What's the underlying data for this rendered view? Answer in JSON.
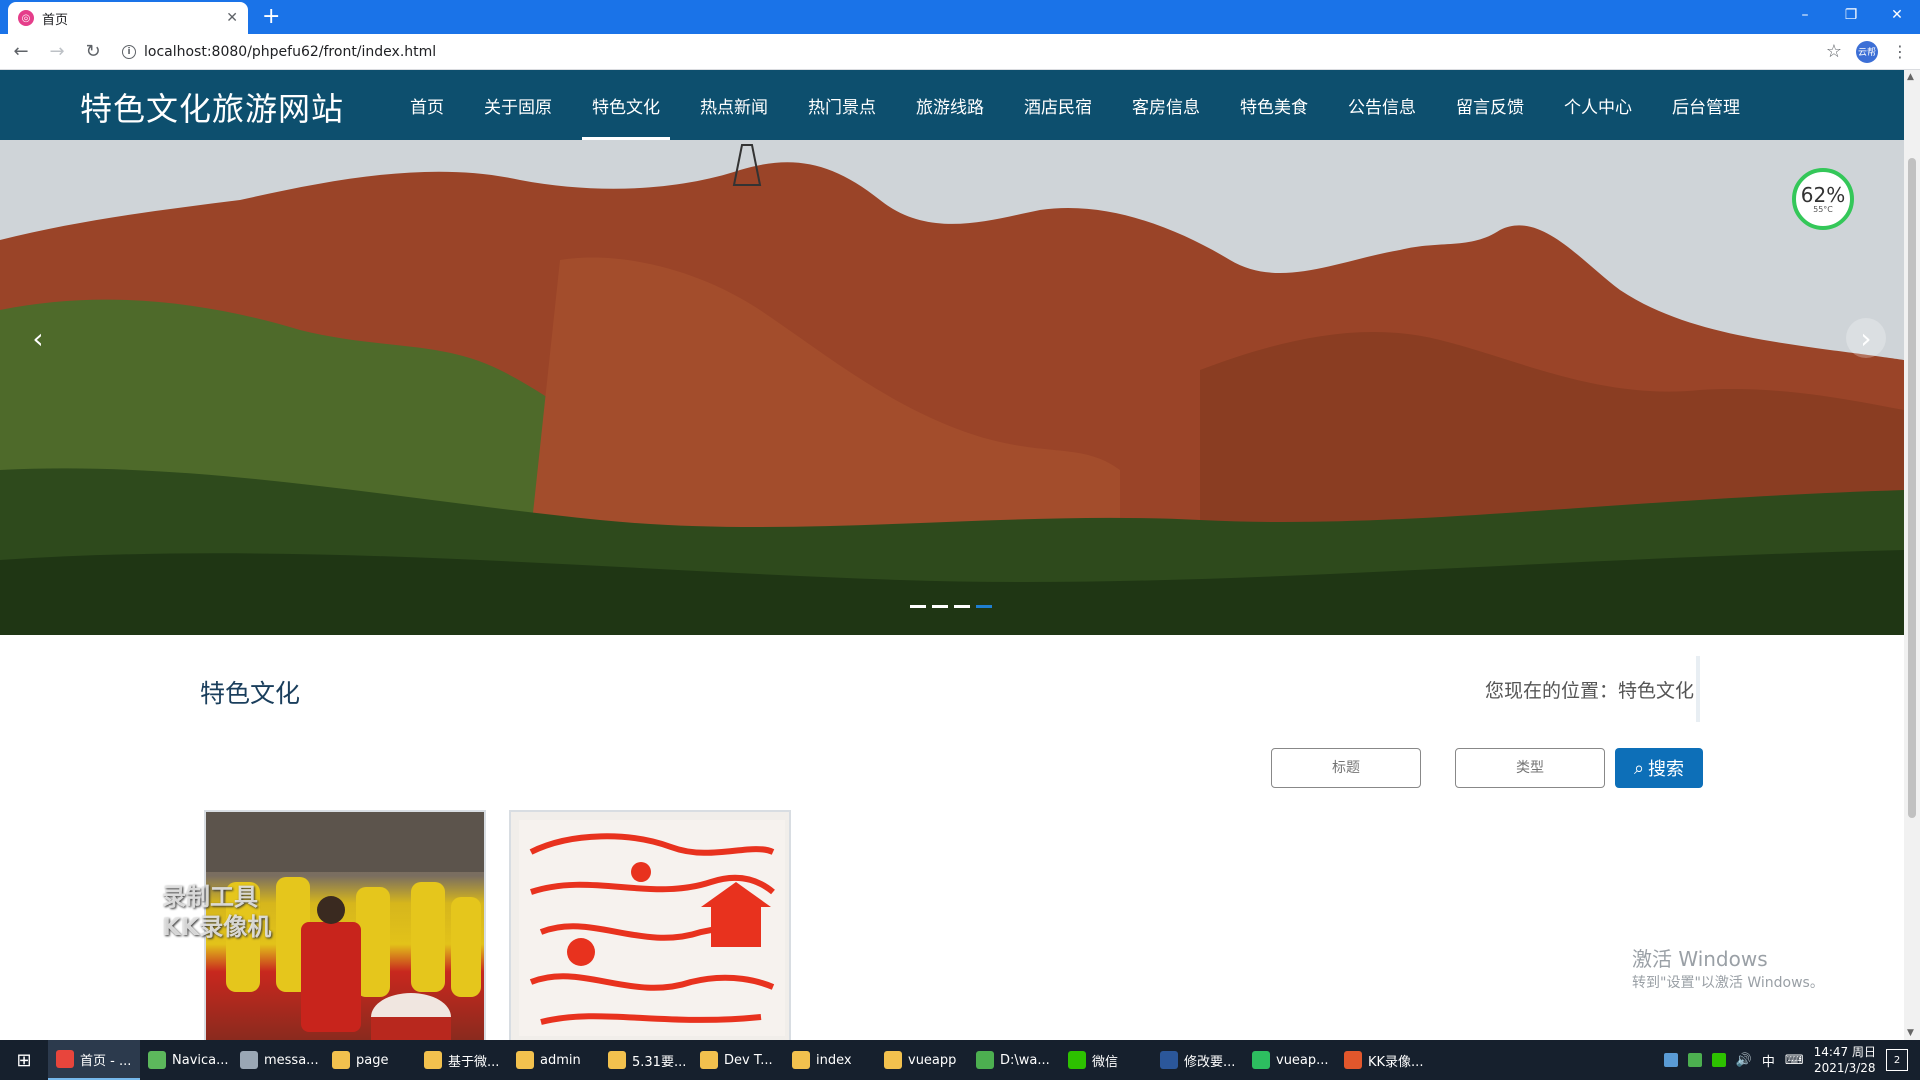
{
  "browser": {
    "tab_title": "首页",
    "url": "localhost:8080/phpefu62/front/index.html",
    "profile_label": "云帮",
    "new_tab": "+",
    "minimize": "–",
    "restore": "❐",
    "close": "✕"
  },
  "site": {
    "logo": "特色文化旅游网站",
    "nav": [
      {
        "label": "首页"
      },
      {
        "label": "关于固原"
      },
      {
        "label": "特色文化",
        "active": true
      },
      {
        "label": "热点新闻"
      },
      {
        "label": "热门景点"
      },
      {
        "label": "旅游线路"
      },
      {
        "label": "酒店民宿"
      },
      {
        "label": "客房信息"
      },
      {
        "label": "特色美食"
      },
      {
        "label": "公告信息"
      },
      {
        "label": "留言反馈"
      },
      {
        "label": "个人中心"
      },
      {
        "label": "后台管理"
      }
    ]
  },
  "banner": {
    "slide_count": 4,
    "active_slide": 4
  },
  "cpu_widget": {
    "percent": "62%",
    "temperature": "55°C"
  },
  "content": {
    "section_title": "特色文化",
    "breadcrumb": "您现在的位置：特色文化",
    "search": {
      "title_placeholder": "标题",
      "type_placeholder": "类型",
      "button_label": "搜索"
    },
    "cards": [
      {
        "icon": "folk-performance-photo"
      },
      {
        "icon": "paper-cut-art-photo"
      }
    ]
  },
  "overlay": {
    "watermark_line1": "录制工具",
    "watermark_line2": "KK录像机",
    "activate_title": "激活 Windows",
    "activate_sub": "转到\"设置\"以激活 Windows。"
  },
  "taskbar": {
    "items": [
      {
        "label": "首页 - ...",
        "color": "#e8453c",
        "active": true
      },
      {
        "label": "Navica...",
        "color": "#5cb85c"
      },
      {
        "label": "messa...",
        "color": "#9aa7b5"
      },
      {
        "label": "page",
        "color": "#f2c14e"
      },
      {
        "label": "基于微...",
        "color": "#f2c14e"
      },
      {
        "label": "admin",
        "color": "#f2c14e"
      },
      {
        "label": "5.31要...",
        "color": "#f2c14e"
      },
      {
        "label": "Dev T...",
        "color": "#f2c14e"
      },
      {
        "label": "index",
        "color": "#f2c14e"
      },
      {
        "label": "vueapp",
        "color": "#f2c14e"
      },
      {
        "label": "D:\\wa...",
        "color": "#4caf50"
      },
      {
        "label": "微信",
        "color": "#2dc100"
      },
      {
        "label": "修改要...",
        "color": "#2b579a"
      },
      {
        "label": "vueap...",
        "color": "#2dbe60"
      },
      {
        "label": "KK录像...",
        "color": "#e2572c"
      }
    ],
    "ime": "中",
    "time": "14:47 周日",
    "date": "2021/3/28",
    "notifications": "2"
  }
}
